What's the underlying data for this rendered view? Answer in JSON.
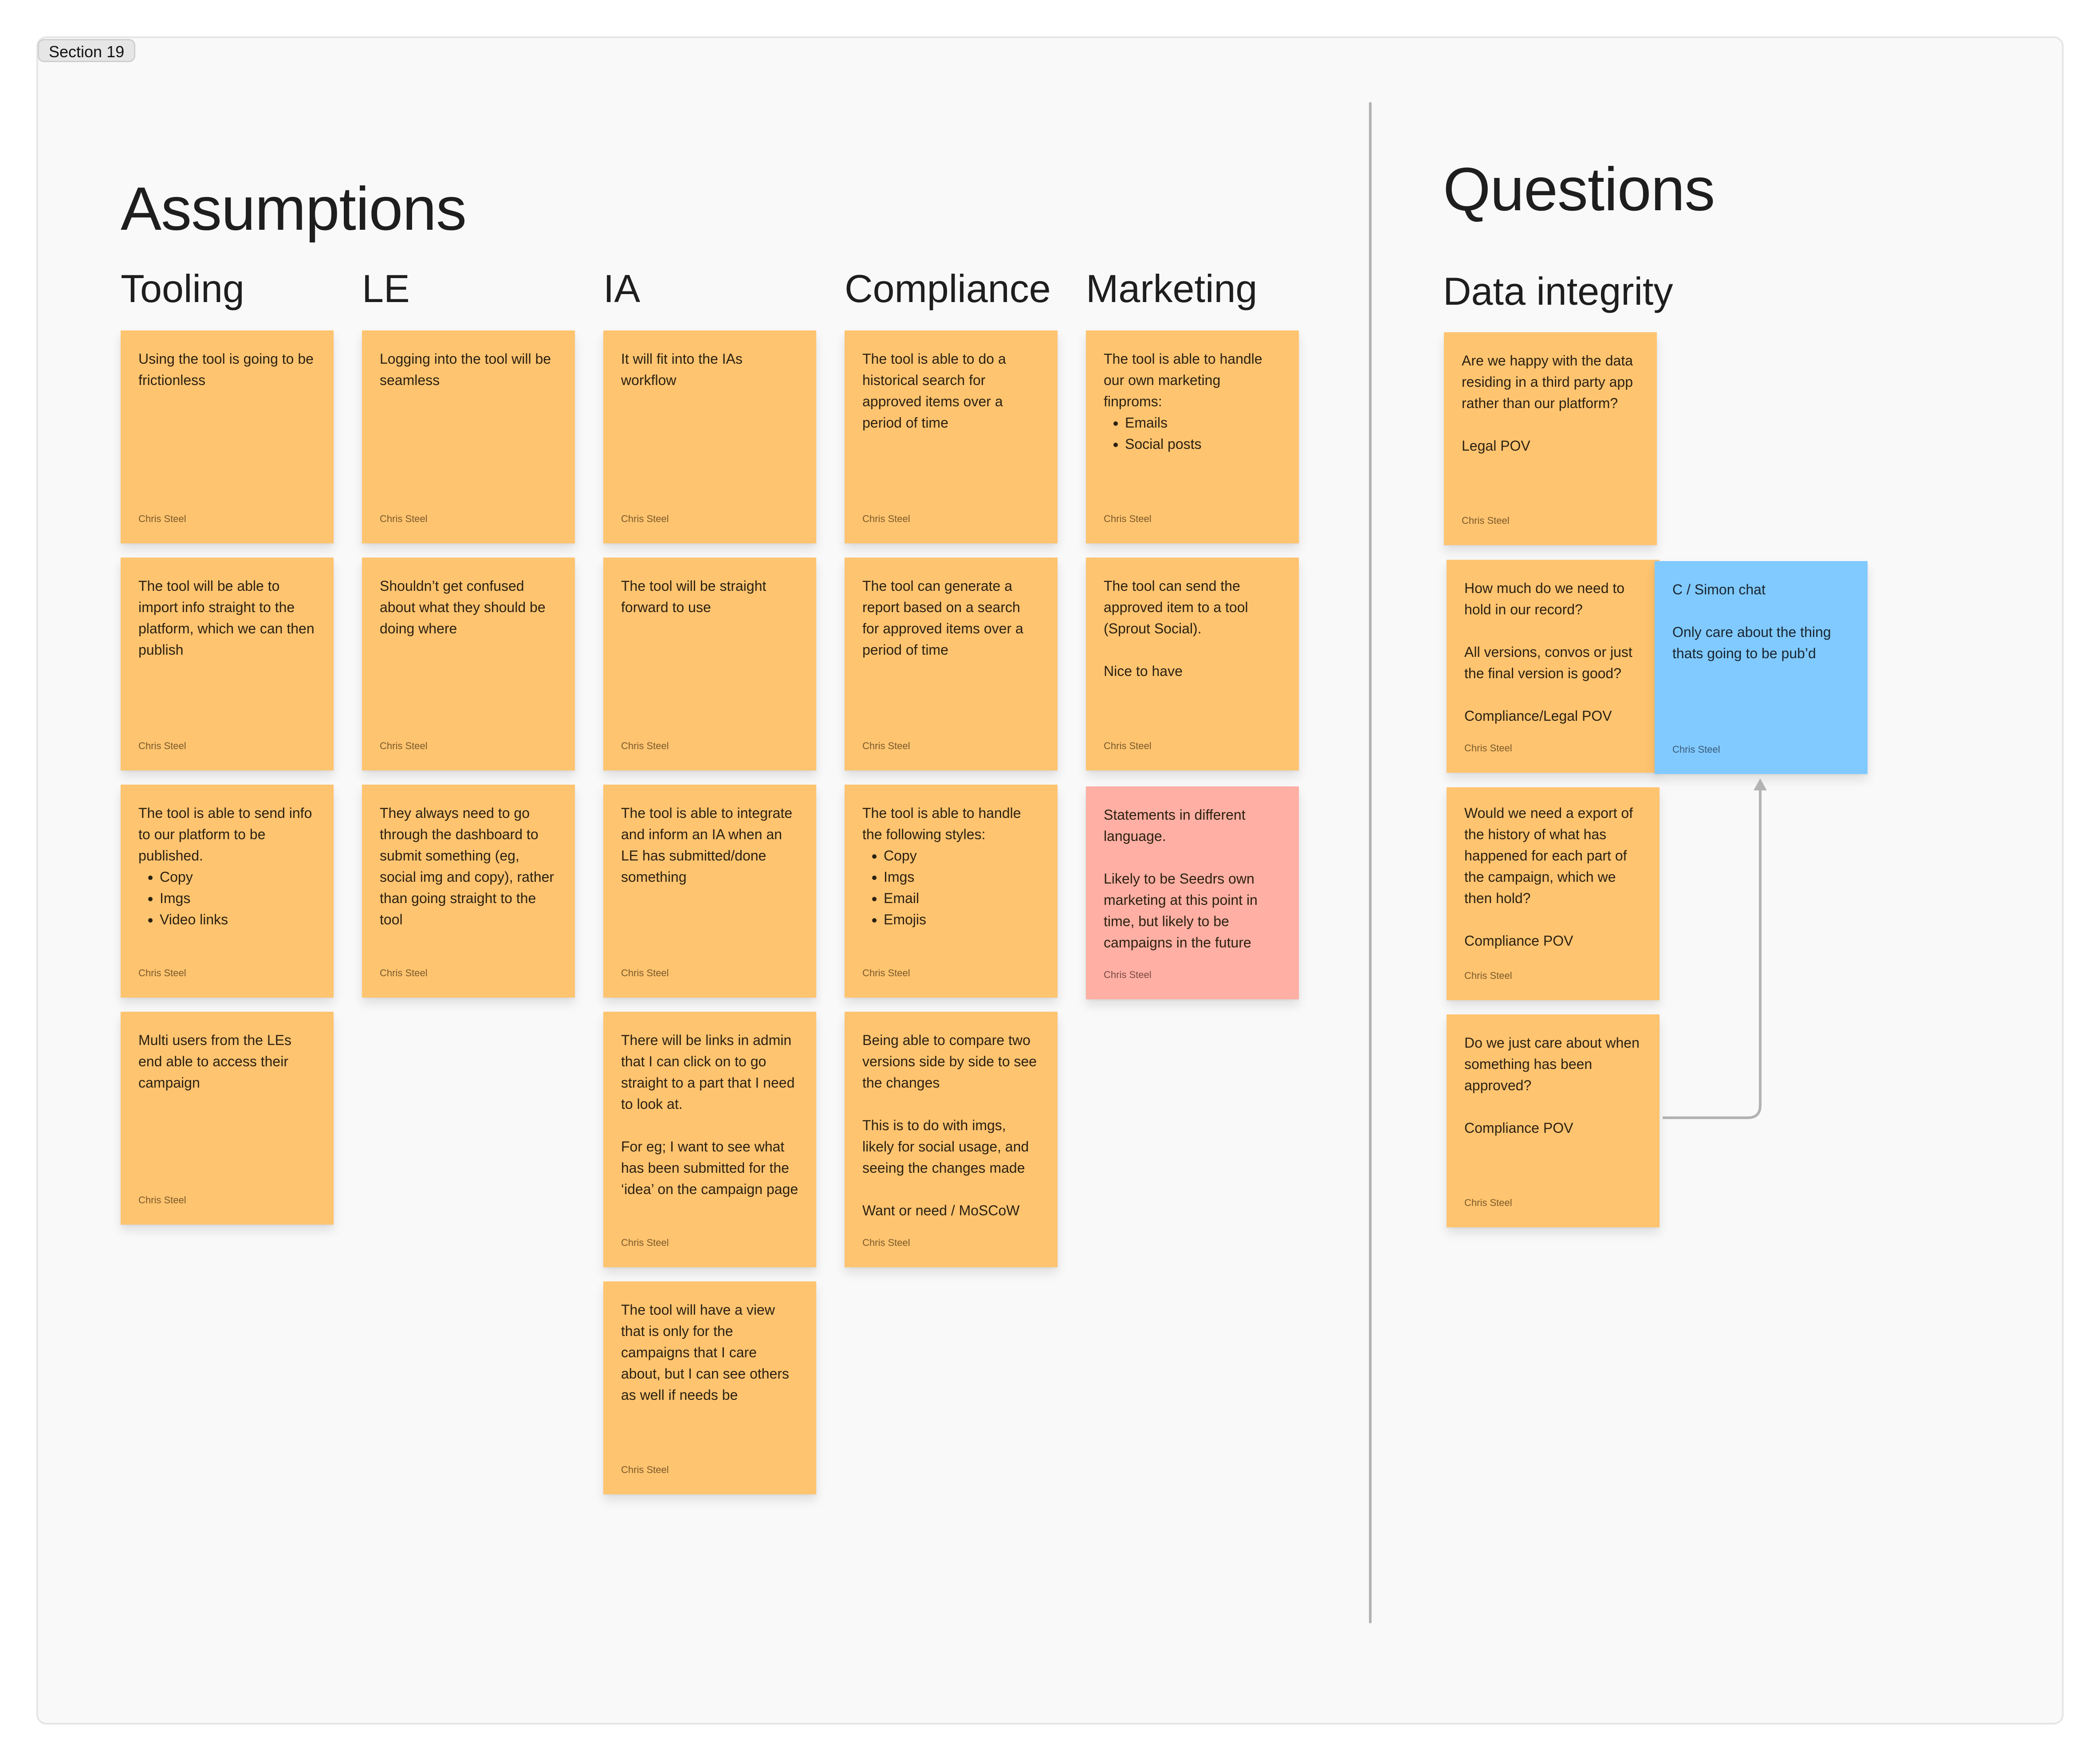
{
  "section": {
    "label": "Section 19"
  },
  "assumptions": {
    "title": "Assumptions",
    "columns": [
      {
        "title": "Tooling",
        "stickies": [
          {
            "text": "Using the tool is going to be frictionless",
            "author": "Chris Steel",
            "color": "orange"
          },
          {
            "text": "The tool will be able to import info straight to the platform, which we can then publish",
            "author": "Chris Steel",
            "color": "orange"
          },
          {
            "text": "The tool is able to send info to our platform to be published.",
            "bullets": [
              "Copy",
              "Imgs",
              "Video links"
            ],
            "author": "Chris Steel",
            "color": "orange"
          },
          {
            "text": "Multi users from the LEs end able to access their campaign",
            "author": "Chris Steel",
            "color": "orange"
          }
        ]
      },
      {
        "title": "LE",
        "stickies": [
          {
            "text": "Logging into the tool will be seamless",
            "author": "Chris Steel",
            "color": "orange"
          },
          {
            "text": "Shouldn’t get confused about what they should be doing where",
            "author": "Chris Steel",
            "color": "orange"
          },
          {
            "text": "They always need to go through the dashboard to submit something (eg, social img and copy), rather than going straight to the tool",
            "author": "Chris Steel",
            "color": "orange"
          }
        ]
      },
      {
        "title": "IA",
        "stickies": [
          {
            "text": "It will fit into the IAs workflow",
            "author": "Chris Steel",
            "color": "orange"
          },
          {
            "text": "The tool will be straight forward to use",
            "author": "Chris Steel",
            "color": "orange"
          },
          {
            "text": "The tool is able to integrate and inform an IA when an LE has submitted/done something",
            "author": "Chris Steel",
            "color": "orange"
          },
          {
            "text": "There will be links in admin that I can click on to go straight to a part that I need to look at.\n\nFor eg; I want to see what has been submitted for the ‘idea’ on the campaign page",
            "author": "Chris Steel",
            "color": "orange"
          },
          {
            "text": "The tool will have a view that is only for the campaigns that I care about, but I can see others as well if needs be",
            "author": "Chris Steel",
            "color": "orange"
          }
        ]
      },
      {
        "title": "Compliance",
        "stickies": [
          {
            "text": "The tool is able to do a historical search for approved items over a period of time",
            "author": "Chris Steel",
            "color": "orange"
          },
          {
            "text": "The tool can generate a report based on a search for approved items over a period of time",
            "author": "Chris Steel",
            "color": "orange"
          },
          {
            "text": "The tool is able to handle the following styles:",
            "bullets": [
              "Copy",
              "Imgs",
              "Email",
              "Emojis"
            ],
            "author": "Chris Steel",
            "color": "orange"
          },
          {
            "text": "Being able to compare two versions side by side to see the changes\n\nThis is to do with imgs, likely for social usage, and seeing the changes made\n\nWant or need / MoSCoW",
            "author": "Chris Steel",
            "color": "orange"
          }
        ]
      },
      {
        "title": "Marketing",
        "stickies": [
          {
            "text": "The tool is able to handle our own marketing finproms:",
            "bullets": [
              "Emails",
              "Social posts"
            ],
            "author": "Chris Steel",
            "color": "orange"
          },
          {
            "text": "The tool can send the approved item to a tool (Sprout Social).\n\nNice to have",
            "author": "Chris Steel",
            "color": "orange"
          },
          {
            "text": "Statements in different language.\n\nLikely to be Seedrs own marketing at this point in time, but likely to be campaigns in the future",
            "author": "Chris Steel",
            "color": "pink"
          }
        ]
      }
    ]
  },
  "questions": {
    "title": "Questions",
    "columns": [
      {
        "title": "Data integrity",
        "stickies": [
          {
            "text": "Are we happy with the data residing in a third party app rather than our platform?\n\nLegal POV",
            "author": "Chris Steel",
            "color": "orange"
          },
          {
            "text": "How much do we need to hold in our record?\n\nAll versions, convos or just the final version is good?\n\nCompliance/Legal POV",
            "author": "Chris Steel",
            "color": "orange"
          },
          {
            "text": "Would we need a export of the history of what has happened for each part of the campaign, which we then hold?\n\nCompliance POV",
            "author": "Chris Steel",
            "color": "orange"
          },
          {
            "text": "Do we just care about when something has been approved?\n\nCompliance POV",
            "author": "Chris Steel",
            "color": "orange"
          }
        ]
      }
    ],
    "side_note": {
      "text": "C / Simon chat\n\nOnly care about the thing thats going to be pub’d",
      "author": "Chris Steel",
      "color": "blue"
    }
  },
  "colors": {
    "orange": "#ffc470",
    "pink": "#ffafa3",
    "blue": "#80caff",
    "connector": "#b3b3b3",
    "board": "#f9f9f9"
  }
}
